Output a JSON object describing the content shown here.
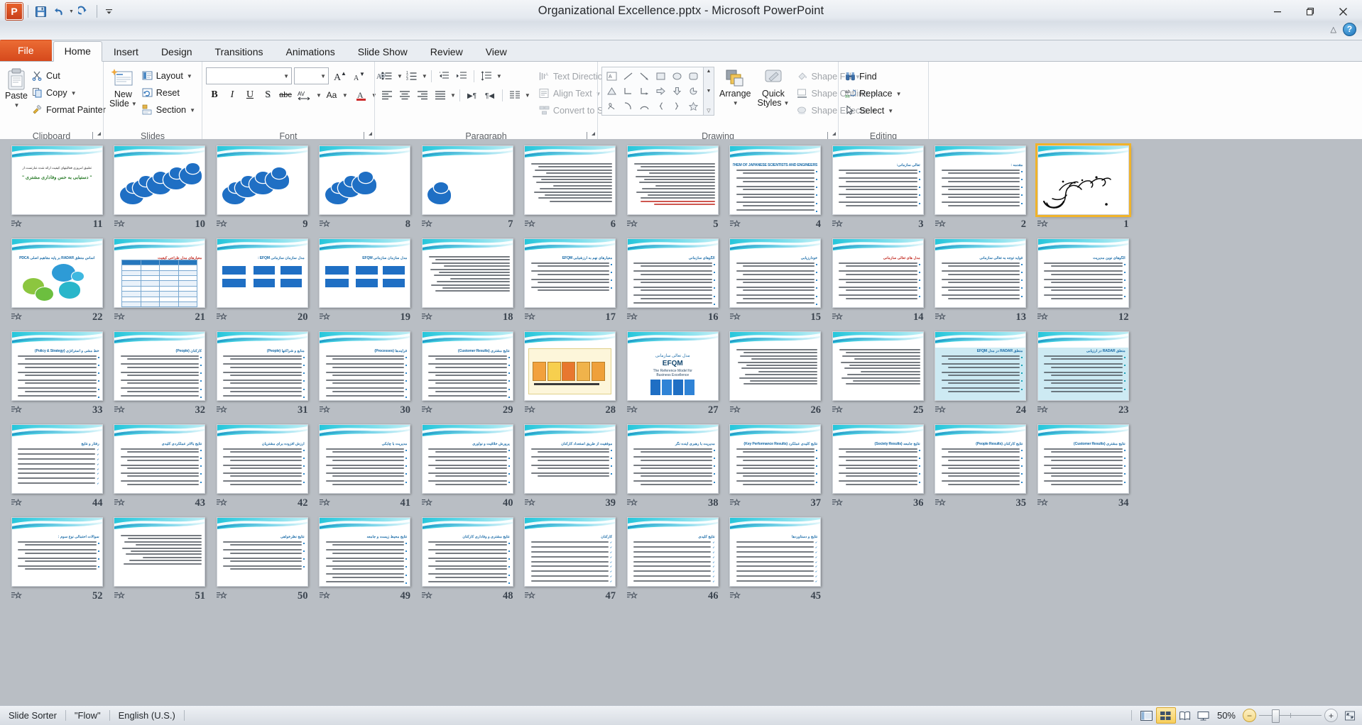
{
  "window": {
    "title": "Organizational Excellence.pptx  -  Microsoft PowerPoint",
    "minimize_label": "—",
    "restore_label": "❐",
    "close_label": "✕",
    "help_label": "?",
    "collapse_ribbon_label": "⌃"
  },
  "quick_access": {
    "app_logo": "powerpoint-logo",
    "items": [
      {
        "name": "save-icon",
        "label": "Save"
      },
      {
        "name": "undo-icon",
        "label": "Undo"
      },
      {
        "name": "redo-icon",
        "label": "Redo"
      },
      {
        "name": "customize-qat-icon",
        "label": "Customize Quick Access Toolbar"
      }
    ]
  },
  "tabs": [
    {
      "label": "File",
      "active": false,
      "kind": "file"
    },
    {
      "label": "Home",
      "active": true,
      "kind": "normal"
    },
    {
      "label": "Insert",
      "active": false,
      "kind": "normal"
    },
    {
      "label": "Design",
      "active": false,
      "kind": "normal"
    },
    {
      "label": "Transitions",
      "active": false,
      "kind": "normal"
    },
    {
      "label": "Animations",
      "active": false,
      "kind": "normal"
    },
    {
      "label": "Slide Show",
      "active": false,
      "kind": "normal"
    },
    {
      "label": "Review",
      "active": false,
      "kind": "normal"
    },
    {
      "label": "View",
      "active": false,
      "kind": "normal"
    }
  ],
  "ribbon": {
    "clipboard": {
      "label": "Clipboard",
      "paste": "Paste",
      "cut": "Cut",
      "copy": "Copy",
      "format_painter": "Format Painter"
    },
    "slides": {
      "label": "Slides",
      "new_slide_line1": "New",
      "new_slide_line2": "Slide",
      "layout": "Layout",
      "reset": "Reset",
      "section": "Section"
    },
    "font": {
      "label": "Font",
      "font_name_value": "",
      "font_size_value": "",
      "grow_font": "A",
      "shrink_font": "A",
      "clear_formatting": "clear-formatting",
      "bold": "B",
      "italic": "I",
      "underline": "U",
      "shadow": "S",
      "strikethrough": "abc",
      "character_spacing": "AV",
      "change_case": "Aa",
      "font_color": "A"
    },
    "paragraph": {
      "label": "Paragraph",
      "text_direction": "Text Direction",
      "align_text": "Align Text",
      "convert_to_smartart": "Convert to SmartArt"
    },
    "drawing": {
      "label": "Drawing",
      "arrange": "Arrange",
      "quick_styles_line1": "Quick",
      "quick_styles_line2": "Styles",
      "shape_fill": "Shape Fill",
      "shape_outline": "Shape Outline",
      "shape_effects": "Shape Effects"
    },
    "editing": {
      "label": "Editing",
      "find": "Find",
      "replace": "Replace",
      "select": "Select"
    }
  },
  "status_bar": {
    "view_name": "Slide Sorter",
    "theme_name": "\"Flow\"",
    "language": "English (U.S.)",
    "zoom_level": "50%",
    "zoom_out": "−",
    "zoom_in": "+",
    "views": [
      {
        "name": "view-normal",
        "label": "Normal",
        "active": false
      },
      {
        "name": "view-slide-sorter",
        "label": "Slide Sorter",
        "active": true
      },
      {
        "name": "view-reading",
        "label": "Reading View",
        "active": false
      },
      {
        "name": "view-slideshow",
        "label": "Slide Show",
        "active": false
      }
    ],
    "fit_to_window": "Fit slide to current window"
  },
  "sorter": {
    "selected_slide": 1,
    "total_slides": 52,
    "slides": [
      {
        "n": 11,
        "kind": "title-quote",
        "title": "تطبیق امروزی فعالیتهای کیفیت ارائه شده عبارتست از",
        "quote": "\" دستیابی به حس وفاداری مشتری \"",
        "anim": true
      },
      {
        "n": 10,
        "kind": "clouds",
        "count": 5,
        "anim": true
      },
      {
        "n": 9,
        "kind": "clouds",
        "count": 4,
        "anim": true
      },
      {
        "n": 8,
        "kind": "clouds",
        "count": 3,
        "anim": true
      },
      {
        "n": 7,
        "kind": "clouds",
        "count": 1,
        "anim": true
      },
      {
        "n": 6,
        "kind": "text-dense",
        "lines": 13,
        "anim": true
      },
      {
        "n": 5,
        "kind": "text-dense-red",
        "lines": 12,
        "anim": true
      },
      {
        "n": 4,
        "kind": "text-title-en",
        "title": "THEM OF JAPANESE SCIENTISTS AND ENGINEERS",
        "lines": 11,
        "anim": true
      },
      {
        "n": 3,
        "kind": "bullets",
        "title": "تعالی سازمانی:",
        "lines": 10,
        "anim": true
      },
      {
        "n": 2,
        "kind": "bullets",
        "title": "مقدمه :",
        "lines": 10,
        "anim": true
      },
      {
        "n": 1,
        "kind": "bismillah",
        "anim": true,
        "selected": true
      },
      {
        "n": 22,
        "kind": "radar-circles",
        "title": "اساس منطق RADAR بر پایه مفاهیم اصلی PDCA",
        "anim": true
      },
      {
        "n": 21,
        "kind": "table",
        "title": "معیارهای مدل طراحی کیفیت",
        "anim": true
      },
      {
        "n": 20,
        "kind": "efqm-diagram",
        "title": "مدل سازمان سازمانی EFQM :",
        "anim": true
      },
      {
        "n": 19,
        "kind": "efqm-diagram",
        "title": "مدل سازمان سازمانی EFQM",
        "anim": true
      },
      {
        "n": 18,
        "kind": "text-dense",
        "lines": 12,
        "anim": true
      },
      {
        "n": 17,
        "kind": "bullets",
        "title": "معیارهای نهم به ارزشیابی EFQM",
        "lines": 8,
        "anim": true
      },
      {
        "n": 16,
        "kind": "bullets",
        "title": "الگوهای سازمانی",
        "lines": 11,
        "anim": true
      },
      {
        "n": 15,
        "kind": "bullets",
        "title": "خودارزیابی",
        "lines": 11,
        "anim": true
      },
      {
        "n": 14,
        "kind": "bullets-red",
        "title": "مدل های تعالی سازمانی",
        "lines": 10,
        "anim": true
      },
      {
        "n": 13,
        "kind": "bullets",
        "title": "فواید توجه به تعالی سازمانی",
        "lines": 9,
        "anim": true
      },
      {
        "n": 12,
        "kind": "bullets",
        "title": "الگوهای نوین مدیریت",
        "lines": 9,
        "anim": true
      },
      {
        "n": 33,
        "kind": "bullets",
        "title": "خط مشی و استراتژی (Policy & Strategy)",
        "lines": 12,
        "anim": true
      },
      {
        "n": 32,
        "kind": "bullets",
        "title": "کارکنان (People)",
        "lines": 12,
        "anim": true
      },
      {
        "n": 31,
        "kind": "bullets",
        "title": "منابع و شراکتها (People)",
        "lines": 11,
        "anim": true
      },
      {
        "n": 30,
        "kind": "bullets",
        "title": "فرآیندها (Processes)",
        "lines": 11,
        "anim": true
      },
      {
        "n": 29,
        "kind": "bullets",
        "title": "نتایج مشتری (Customer Results)",
        "lines": 11,
        "anim": true
      },
      {
        "n": 28,
        "kind": "efqm-color-map",
        "anim": true
      },
      {
        "n": 27,
        "kind": "efqm-title",
        "title_fa": "مدل تعالی سازمانی",
        "title_en": "EFQM",
        "sub1": "The Reference Model for",
        "sub2": "Business Excellence",
        "anim": true
      },
      {
        "n": 26,
        "kind": "text-dense",
        "lines": 12,
        "anim": true
      },
      {
        "n": 25,
        "kind": "text-dense",
        "lines": 12,
        "anim": true
      },
      {
        "n": 24,
        "kind": "bullets-cyan",
        "title": "منطق RADAR در مدل EFQM",
        "lines": 10,
        "anim": true
      },
      {
        "n": 23,
        "kind": "bullets-cyan",
        "title": "منطق RADAR در ارزیابی",
        "lines": 9,
        "anim": true
      },
      {
        "n": 44,
        "kind": "checklist",
        "title": "رفتار و نتایج",
        "lines": 8,
        "anim": true
      },
      {
        "n": 43,
        "kind": "bullets",
        "title": "نتایج بالاتر عملکردی کلیدی",
        "lines": 10,
        "anim": true
      },
      {
        "n": 42,
        "kind": "bullets",
        "title": "ارزش افزوده برای مشتریان",
        "lines": 10,
        "anim": true
      },
      {
        "n": 41,
        "kind": "bullets-box",
        "title": "مدیریت با چابکی",
        "lines": 10,
        "anim": true
      },
      {
        "n": 40,
        "kind": "bullets-box",
        "title": "پرورش خلاقیت و نوآوری",
        "lines": 10,
        "anim": true
      },
      {
        "n": 39,
        "kind": "bullets-lg",
        "title": "موفقیت از طریق استعداد کارکنان",
        "lines": 7,
        "anim": true
      },
      {
        "n": 38,
        "kind": "bullets",
        "title": "مدیریت با رهبری آینده نگر",
        "lines": 10,
        "anim": true
      },
      {
        "n": 37,
        "kind": "bullets",
        "title": "نتایج کلیدی عملکرد (Key Performance Results)",
        "lines": 10,
        "anim": true
      },
      {
        "n": 36,
        "kind": "bullets",
        "title": "نتایج جامعه (Society Results)",
        "lines": 10,
        "anim": true
      },
      {
        "n": 35,
        "kind": "bullets",
        "title": "نتایج کارکنان (People Results)",
        "lines": 10,
        "anim": true
      },
      {
        "n": 34,
        "kind": "bullets",
        "title": "نتایج مشتری (Customer Results)",
        "lines": 10,
        "anim": true
      },
      {
        "n": 52,
        "kind": "bullets",
        "title": "سوالات احتمالی نوع سوم :",
        "lines": 8,
        "anim": true
      },
      {
        "n": 51,
        "kind": "text-dense",
        "lines": 10,
        "anim": true
      },
      {
        "n": 50,
        "kind": "bullets",
        "title": "نتایج نظرخواهی",
        "lines": 8,
        "anim": true
      },
      {
        "n": 49,
        "kind": "bullets",
        "title": "نتایج محیط زیست و جامعه",
        "lines": 11,
        "anim": true
      },
      {
        "n": 48,
        "kind": "bullets",
        "title": "نتایج مشتری و وفاداری کارکنان",
        "lines": 11,
        "anim": true
      },
      {
        "n": 47,
        "kind": "checklist",
        "title": "کارکنان",
        "lines": 9,
        "anim": true
      },
      {
        "n": 46,
        "kind": "checklist",
        "title": "نتایج کلیدی",
        "lines": 9,
        "anim": true
      },
      {
        "n": 45,
        "kind": "checklist",
        "title": "نتایج و دستاوردها",
        "lines": 9,
        "anim": true
      }
    ]
  }
}
